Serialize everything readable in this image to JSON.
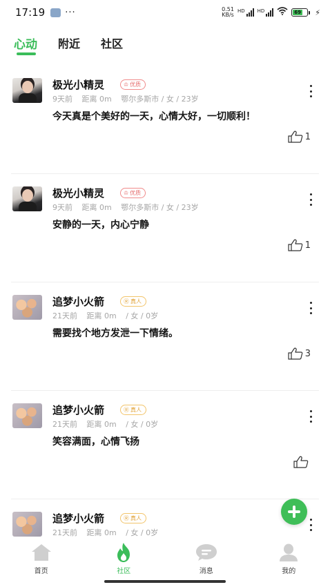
{
  "status_bar": {
    "time": "17:19",
    "dots": "···",
    "net_speed_value": "0.51",
    "net_speed_unit": "KB/s",
    "signal_label": "HD",
    "battery": "69"
  },
  "tabs": [
    {
      "label": "心动",
      "active": true
    },
    {
      "label": "附近",
      "active": false
    },
    {
      "label": "社区",
      "active": false
    }
  ],
  "posts": [
    {
      "username": "极光小精灵",
      "badge": "优质",
      "time": "9天前",
      "distance": "距离 0m",
      "info": "鄂尔多斯市 / 女 / 23岁",
      "content": "今天真是个美好的一天，心情大好，一切顺利！",
      "likes": "1"
    },
    {
      "username": "极光小精灵",
      "badge": "优质",
      "time": "9天前",
      "distance": "距离 0m",
      "info": "鄂尔多斯市 / 女 / 23岁",
      "content": "安静的一天，内心宁静",
      "likes": "1"
    },
    {
      "username": "追梦小火箭",
      "badge": "真人",
      "time": "21天前",
      "distance": "距离 0m",
      "info": "/ 女 / 0岁",
      "content": "需要找个地方发泄一下情绪。",
      "likes": "3"
    },
    {
      "username": "追梦小火箭",
      "badge": "真人",
      "time": "21天前",
      "distance": "距离 0m",
      "info": "/ 女 / 0岁",
      "content": "笑容满面，心情飞扬",
      "likes": ""
    },
    {
      "username": "追梦小火箭",
      "badge": "真人",
      "time": "21天前",
      "distance": "距离 0m",
      "info": "/ 女 / 0岁",
      "content": "",
      "likes": ""
    }
  ],
  "bottom_nav": [
    {
      "label": "首页",
      "icon": "home-icon",
      "active": false
    },
    {
      "label": "社区",
      "icon": "flame-icon",
      "active": true
    },
    {
      "label": "消息",
      "icon": "chat-icon",
      "active": false
    },
    {
      "label": "我的",
      "icon": "profile-icon",
      "active": false
    }
  ],
  "colors": {
    "accent": "#3bbd5a",
    "badge_premium": "#e56b6b",
    "badge_real": "#e0a235",
    "meta_text": "#a5a5a5"
  }
}
